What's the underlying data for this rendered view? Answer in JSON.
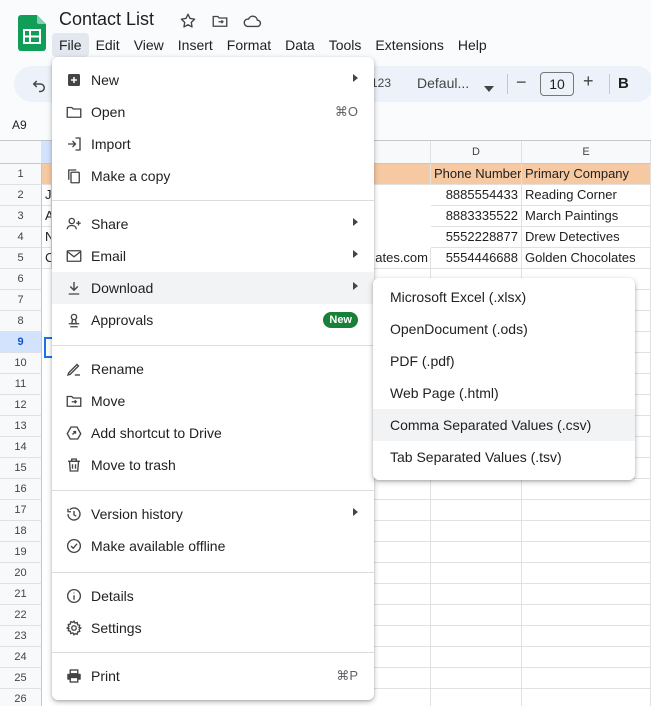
{
  "doc": {
    "title": "Contact List"
  },
  "menubar": [
    "File",
    "Edit",
    "View",
    "Insert",
    "Format",
    "Data",
    "Tools",
    "Extensions",
    "Help"
  ],
  "toolbar": {
    "format_123": "123",
    "font": "Defaul...",
    "font_size": "10",
    "bold": "B",
    "minus": "−",
    "plus": "+"
  },
  "namebox": "A9",
  "grid": {
    "columns": [
      "D",
      "E"
    ],
    "header_row": {
      "phone": "Phone Number",
      "company": "Primary Company"
    },
    "rows": [
      {
        "a": "J",
        "c": "",
        "phone": "8885554433",
        "company": "Reading Corner"
      },
      {
        "a": "A",
        "c": "",
        "phone": "8883335522",
        "company": "March Paintings"
      },
      {
        "a": "N",
        "c": "",
        "phone": "5552228877",
        "company": "Drew Detectives"
      },
      {
        "a": "C",
        "c": "ates.com",
        "phone": "5554446688",
        "company": "Golden Chocolates"
      }
    ],
    "row_numbers": [
      "1",
      "2",
      "3",
      "4",
      "5",
      "6",
      "7",
      "8",
      "9",
      "10",
      "11",
      "12",
      "13",
      "14",
      "15",
      "16",
      "17",
      "18",
      "19",
      "20",
      "21",
      "22",
      "23",
      "24",
      "25",
      "26"
    ]
  },
  "file_menu": {
    "groups": [
      [
        {
          "label": "New",
          "icon": "plus-box-icon",
          "submenu": true
        },
        {
          "label": "Open",
          "icon": "folder-icon",
          "shortcut": "⌘O"
        },
        {
          "label": "Import",
          "icon": "import-icon"
        },
        {
          "label": "Make a copy",
          "icon": "copy-icon"
        }
      ],
      [
        {
          "label": "Share",
          "icon": "person-add-icon",
          "submenu": true
        },
        {
          "label": "Email",
          "icon": "mail-icon",
          "submenu": true
        },
        {
          "label": "Download",
          "icon": "download-icon",
          "submenu": true,
          "highlight": true
        },
        {
          "label": "Approvals",
          "icon": "approvals-icon",
          "badge": "New"
        }
      ],
      [
        {
          "label": "Rename",
          "icon": "rename-icon"
        },
        {
          "label": "Move",
          "icon": "move-folder-icon"
        },
        {
          "label": "Add shortcut to Drive",
          "icon": "drive-shortcut-icon"
        },
        {
          "label": "Move to trash",
          "icon": "trash-icon"
        }
      ],
      [
        {
          "label": "Version history",
          "icon": "history-icon",
          "submenu": true
        },
        {
          "label": "Make available offline",
          "icon": "offline-icon"
        }
      ],
      [
        {
          "label": "Details",
          "icon": "info-icon"
        },
        {
          "label": "Settings",
          "icon": "gear-icon"
        }
      ],
      [
        {
          "label": "Print",
          "icon": "print-icon",
          "shortcut": "⌘P"
        }
      ]
    ]
  },
  "download_menu": [
    {
      "label": "Microsoft Excel (.xlsx)"
    },
    {
      "label": "OpenDocument (.ods)"
    },
    {
      "label": "PDF (.pdf)"
    },
    {
      "label": "Web Page (.html)"
    },
    {
      "label": "Comma Separated Values (.csv)",
      "highlight": true
    },
    {
      "label": "Tab Separated Values (.tsv)"
    }
  ],
  "colors": {
    "header_fill": "#f6c9a3",
    "selection": "#1a73e8",
    "badge": "#188038",
    "sheets_green": "#0f9d58"
  }
}
